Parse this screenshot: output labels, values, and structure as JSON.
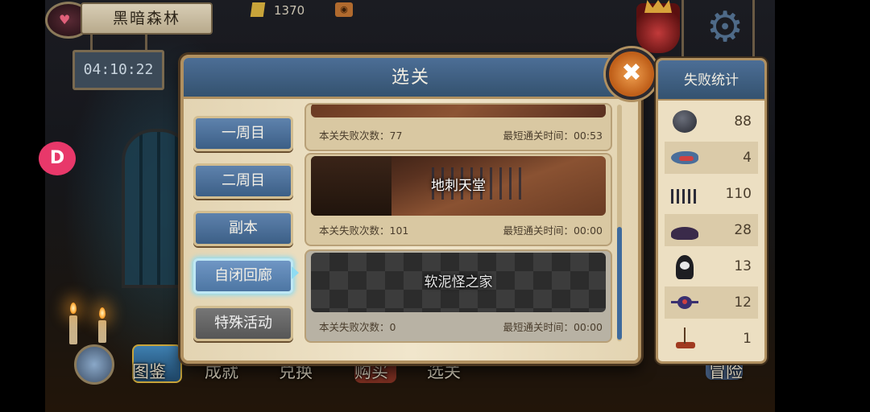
{
  "hud": {
    "zone_name": "黑暗森林",
    "timer": "04:10:22",
    "gold": "1370"
  },
  "side_badge": "D",
  "bottom_nav": [
    "图鉴",
    "成就",
    "兑换",
    "购买",
    "选关",
    "冒险"
  ],
  "panel": {
    "title": "选关",
    "close_icon": "✖",
    "categories": [
      {
        "label": "一周目",
        "state": "normal"
      },
      {
        "label": "二周目",
        "state": "normal"
      },
      {
        "label": "副本",
        "state": "normal"
      },
      {
        "label": "自闭回廊",
        "state": "selected"
      },
      {
        "label": "特殊活动",
        "state": "disabled"
      }
    ],
    "levels": [
      {
        "name": "",
        "fail_label": "本关失败次数：77",
        "time_label": "最短通关时间：00:53"
      },
      {
        "name": "地刺天堂",
        "fail_label": "本关失败次数：101",
        "time_label": "最短通关时间：00:00"
      },
      {
        "name": "软泥怪之家",
        "fail_label": "本关失败次数：0",
        "time_label": "最短通关时间：00:00"
      }
    ]
  },
  "fail_stats": {
    "title": "失败统计",
    "rows": [
      {
        "icon": "boulder-icon",
        "value": "88"
      },
      {
        "icon": "piranha-icon",
        "value": "4"
      },
      {
        "icon": "spikes-icon",
        "value": "110"
      },
      {
        "icon": "slime-icon",
        "value": "28"
      },
      {
        "icon": "ghost-icon",
        "value": "13"
      },
      {
        "icon": "spider-icon",
        "value": "12"
      },
      {
        "icon": "campfire-icon",
        "value": "1"
      }
    ]
  },
  "colors": {
    "header_blue": "#4c6e96",
    "parchment": "#ecdfc2",
    "frame_gold": "#b09060",
    "close_orange": "#e07a30",
    "selected_glow": "#8fdcf2"
  }
}
